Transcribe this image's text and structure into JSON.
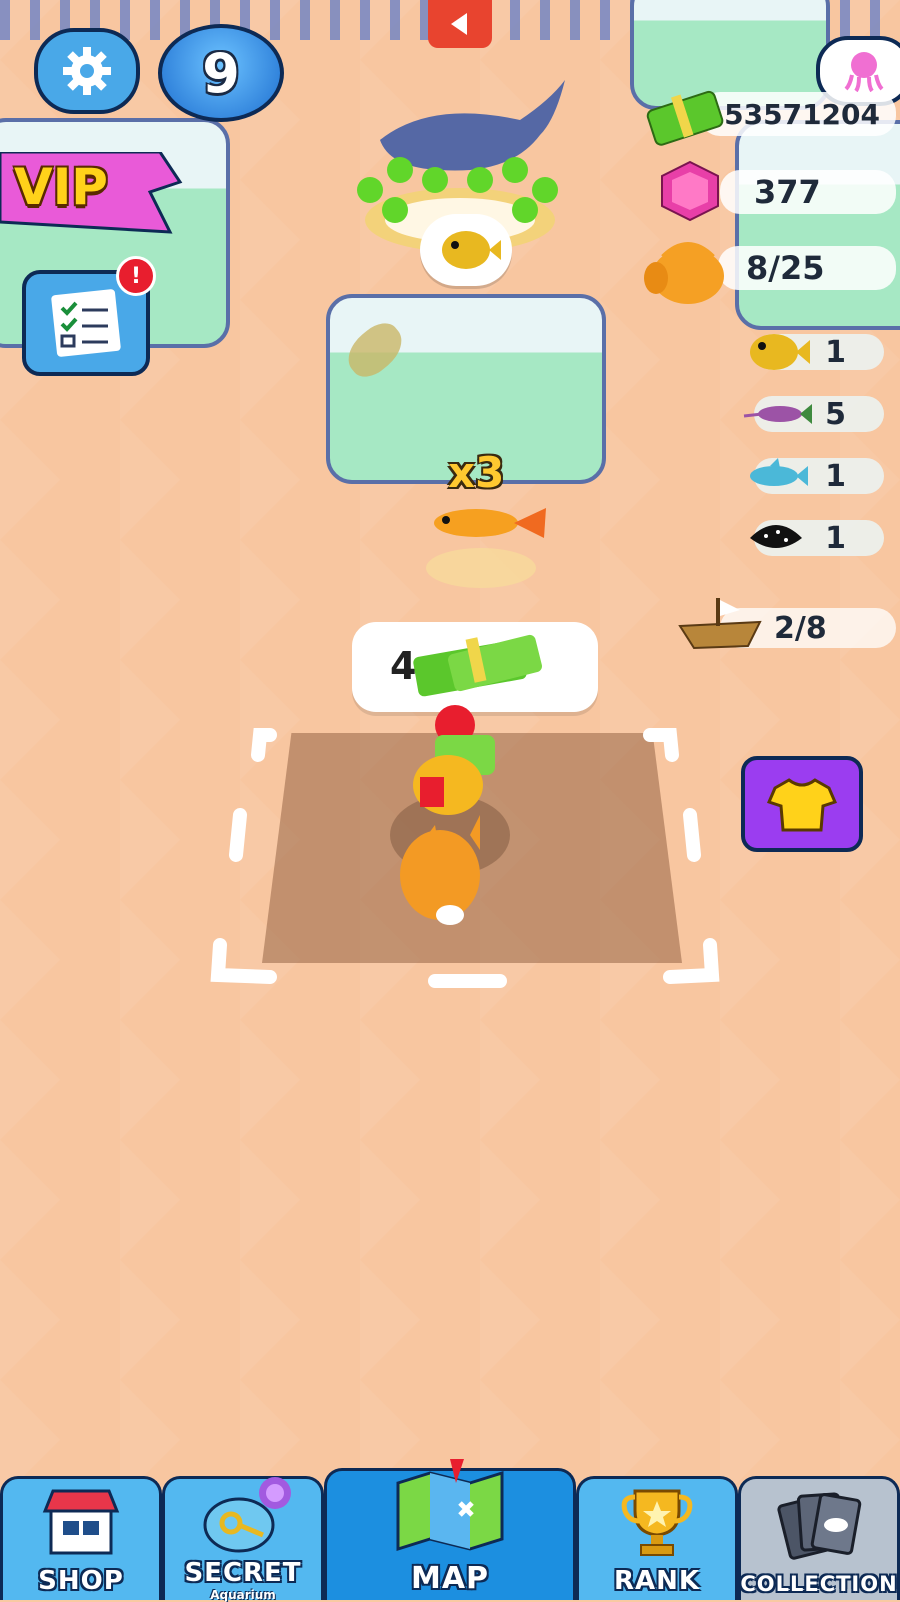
{
  "hud": {
    "level": "9",
    "vip_label": "VIP",
    "money": "53571204",
    "gems": "377",
    "bag": "8/25"
  },
  "fish_counts": [
    {
      "icon": "pufferfish-icon",
      "count": "1"
    },
    {
      "icon": "swordfish-icon",
      "count": "5"
    },
    {
      "icon": "dolphin-icon",
      "count": "1"
    },
    {
      "icon": "stingray-icon",
      "count": "1"
    }
  ],
  "ship": {
    "progress": "2/8"
  },
  "scene": {
    "multiplier": "x3",
    "cost_partial": "4"
  },
  "nav": {
    "shop": "SHOP",
    "secret": "SECRET",
    "secret_sub": "Aquarium",
    "map": "MAP",
    "rank": "RANK",
    "collection": "COLLECTION"
  },
  "colors": {
    "floor": "#f8c6a0",
    "nav_active": "#1c8fe0",
    "nav_default": "#53b8f0",
    "vip_pink": "#e95ad8",
    "shirt_button": "#9b3df0"
  }
}
